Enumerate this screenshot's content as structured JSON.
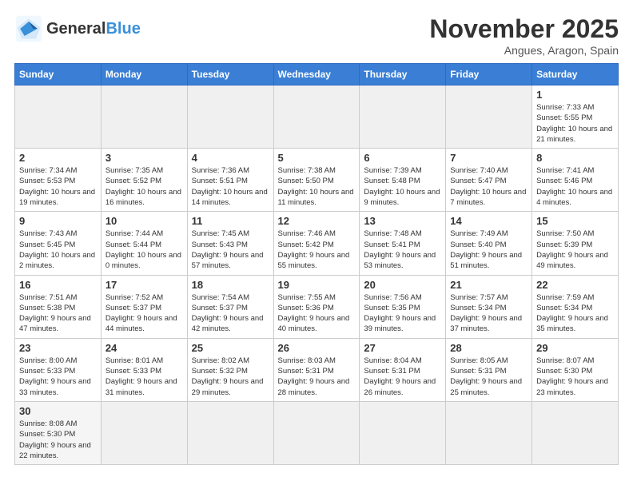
{
  "header": {
    "logo_general": "General",
    "logo_blue": "Blue",
    "month_title": "November 2025",
    "location": "Angues, Aragon, Spain"
  },
  "weekdays": [
    "Sunday",
    "Monday",
    "Tuesday",
    "Wednesday",
    "Thursday",
    "Friday",
    "Saturday"
  ],
  "days": {
    "d1": {
      "num": "1",
      "sunrise": "7:33 AM",
      "sunset": "5:55 PM",
      "daylight": "10 hours and 21 minutes."
    },
    "d2": {
      "num": "2",
      "sunrise": "7:34 AM",
      "sunset": "5:53 PM",
      "daylight": "10 hours and 19 minutes."
    },
    "d3": {
      "num": "3",
      "sunrise": "7:35 AM",
      "sunset": "5:52 PM",
      "daylight": "10 hours and 16 minutes."
    },
    "d4": {
      "num": "4",
      "sunrise": "7:36 AM",
      "sunset": "5:51 PM",
      "daylight": "10 hours and 14 minutes."
    },
    "d5": {
      "num": "5",
      "sunrise": "7:38 AM",
      "sunset": "5:50 PM",
      "daylight": "10 hours and 11 minutes."
    },
    "d6": {
      "num": "6",
      "sunrise": "7:39 AM",
      "sunset": "5:48 PM",
      "daylight": "10 hours and 9 minutes."
    },
    "d7": {
      "num": "7",
      "sunrise": "7:40 AM",
      "sunset": "5:47 PM",
      "daylight": "10 hours and 7 minutes."
    },
    "d8": {
      "num": "8",
      "sunrise": "7:41 AM",
      "sunset": "5:46 PM",
      "daylight": "10 hours and 4 minutes."
    },
    "d9": {
      "num": "9",
      "sunrise": "7:43 AM",
      "sunset": "5:45 PM",
      "daylight": "10 hours and 2 minutes."
    },
    "d10": {
      "num": "10",
      "sunrise": "7:44 AM",
      "sunset": "5:44 PM",
      "daylight": "10 hours and 0 minutes."
    },
    "d11": {
      "num": "11",
      "sunrise": "7:45 AM",
      "sunset": "5:43 PM",
      "daylight": "9 hours and 57 minutes."
    },
    "d12": {
      "num": "12",
      "sunrise": "7:46 AM",
      "sunset": "5:42 PM",
      "daylight": "9 hours and 55 minutes."
    },
    "d13": {
      "num": "13",
      "sunrise": "7:48 AM",
      "sunset": "5:41 PM",
      "daylight": "9 hours and 53 minutes."
    },
    "d14": {
      "num": "14",
      "sunrise": "7:49 AM",
      "sunset": "5:40 PM",
      "daylight": "9 hours and 51 minutes."
    },
    "d15": {
      "num": "15",
      "sunrise": "7:50 AM",
      "sunset": "5:39 PM",
      "daylight": "9 hours and 49 minutes."
    },
    "d16": {
      "num": "16",
      "sunrise": "7:51 AM",
      "sunset": "5:38 PM",
      "daylight": "9 hours and 47 minutes."
    },
    "d17": {
      "num": "17",
      "sunrise": "7:52 AM",
      "sunset": "5:37 PM",
      "daylight": "9 hours and 44 minutes."
    },
    "d18": {
      "num": "18",
      "sunrise": "7:54 AM",
      "sunset": "5:37 PM",
      "daylight": "9 hours and 42 minutes."
    },
    "d19": {
      "num": "19",
      "sunrise": "7:55 AM",
      "sunset": "5:36 PM",
      "daylight": "9 hours and 40 minutes."
    },
    "d20": {
      "num": "20",
      "sunrise": "7:56 AM",
      "sunset": "5:35 PM",
      "daylight": "9 hours and 39 minutes."
    },
    "d21": {
      "num": "21",
      "sunrise": "7:57 AM",
      "sunset": "5:34 PM",
      "daylight": "9 hours and 37 minutes."
    },
    "d22": {
      "num": "22",
      "sunrise": "7:59 AM",
      "sunset": "5:34 PM",
      "daylight": "9 hours and 35 minutes."
    },
    "d23": {
      "num": "23",
      "sunrise": "8:00 AM",
      "sunset": "5:33 PM",
      "daylight": "9 hours and 33 minutes."
    },
    "d24": {
      "num": "24",
      "sunrise": "8:01 AM",
      "sunset": "5:33 PM",
      "daylight": "9 hours and 31 minutes."
    },
    "d25": {
      "num": "25",
      "sunrise": "8:02 AM",
      "sunset": "5:32 PM",
      "daylight": "9 hours and 29 minutes."
    },
    "d26": {
      "num": "26",
      "sunrise": "8:03 AM",
      "sunset": "5:31 PM",
      "daylight": "9 hours and 28 minutes."
    },
    "d27": {
      "num": "27",
      "sunrise": "8:04 AM",
      "sunset": "5:31 PM",
      "daylight": "9 hours and 26 minutes."
    },
    "d28": {
      "num": "28",
      "sunrise": "8:05 AM",
      "sunset": "5:31 PM",
      "daylight": "9 hours and 25 minutes."
    },
    "d29": {
      "num": "29",
      "sunrise": "8:07 AM",
      "sunset": "5:30 PM",
      "daylight": "9 hours and 23 minutes."
    },
    "d30": {
      "num": "30",
      "sunrise": "8:08 AM",
      "sunset": "5:30 PM",
      "daylight": "9 hours and 22 minutes."
    }
  }
}
